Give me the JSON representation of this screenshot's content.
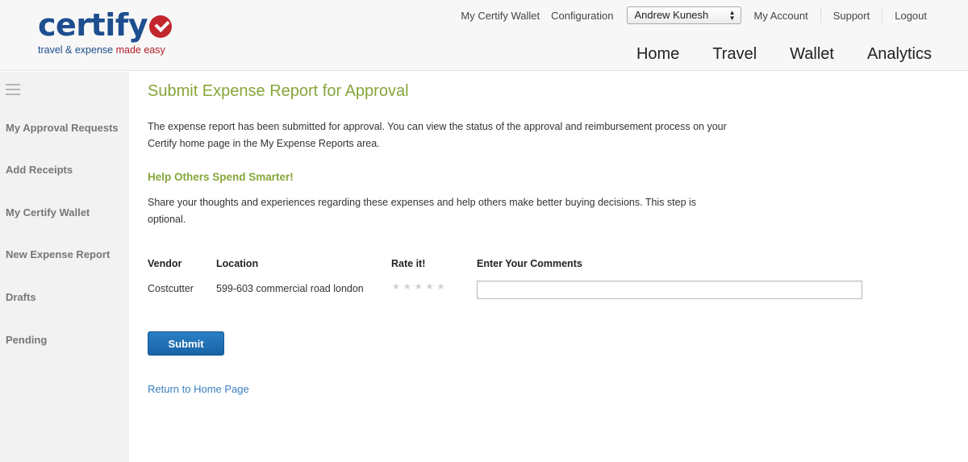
{
  "brand": {
    "name": "certify",
    "tagline_part1": "travel & expense ",
    "tagline_part2": "made easy",
    "colors": {
      "primary": "#1d4e8f",
      "accent": "#c1272d",
      "green": "#86a63a",
      "button": "#1a63a6",
      "link": "#3b80c0"
    }
  },
  "top_links": {
    "wallet": "My Certify Wallet",
    "configuration": "Configuration",
    "user_select_value": "Andrew Kunesh",
    "account": "My Account",
    "support": "Support",
    "logout": "Logout"
  },
  "main_nav": [
    "Home",
    "Travel",
    "Wallet",
    "Analytics"
  ],
  "sidebar": {
    "menu_icon": "hamburger-icon",
    "items": [
      {
        "label": "My Approval Requests"
      },
      {
        "label": "Add Receipts"
      },
      {
        "label": "My Certify Wallet"
      },
      {
        "label": "New Expense Report"
      },
      {
        "label": "Drafts"
      },
      {
        "label": "Pending"
      }
    ]
  },
  "main": {
    "title": "Submit Expense Report for Approval",
    "intro_text": "The expense report has been submitted for approval. You can view the status of the approval and reimbursement process on your Certify home page in the My Expense Reports area.",
    "subtitle": "Help Others Spend Smarter!",
    "share_text": "Share your thoughts and experiences regarding these expenses and help others make better buying decisions. This step is optional.",
    "table": {
      "headers": {
        "vendor": "Vendor",
        "location": "Location",
        "rate": "Rate it!",
        "comments": "Enter Your Comments"
      },
      "rows": [
        {
          "vendor": "Costcutter",
          "location": "599-603 commercial road london",
          "rating": 0,
          "max_rating": 5,
          "comment": ""
        }
      ]
    },
    "submit_label": "Submit",
    "return_link": "Return to Home Page"
  }
}
